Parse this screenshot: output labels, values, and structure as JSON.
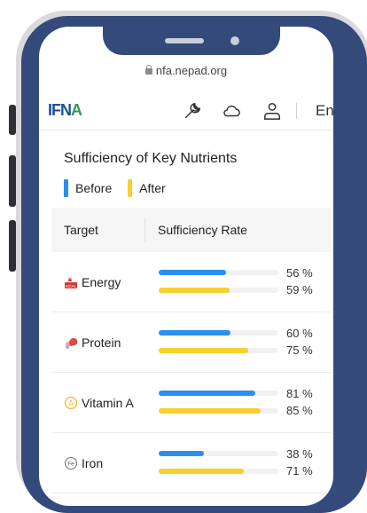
{
  "browser": {
    "url": "nfa.nepad.org"
  },
  "header": {
    "logo_text": "IFNA",
    "language": "En"
  },
  "page": {
    "title": "Sufficiency of Key Nutrients"
  },
  "legend": {
    "before_label": "Before",
    "after_label": "After",
    "before_color": "#2b8ff0",
    "after_color": "#f7d02e"
  },
  "table": {
    "col_target": "Target",
    "col_rate": "Sufficiency Rate",
    "rows": [
      {
        "name": "Energy",
        "icon": "energy-kcal-icon",
        "before": 56,
        "after": 59,
        "before_label": "56 %",
        "after_label": "59 %"
      },
      {
        "name": "Protein",
        "icon": "protein-icon",
        "before": 60,
        "after": 75,
        "before_label": "60 %",
        "after_label": "75 %"
      },
      {
        "name": "Vitamin A",
        "icon": "vitamin-a-icon",
        "before": 81,
        "after": 85,
        "before_label": "81 %",
        "after_label": "85 %"
      },
      {
        "name": "Iron",
        "icon": "iron-fe-icon",
        "before": 38,
        "after": 71,
        "before_label": "38 %",
        "after_label": "71 %"
      }
    ]
  }
}
